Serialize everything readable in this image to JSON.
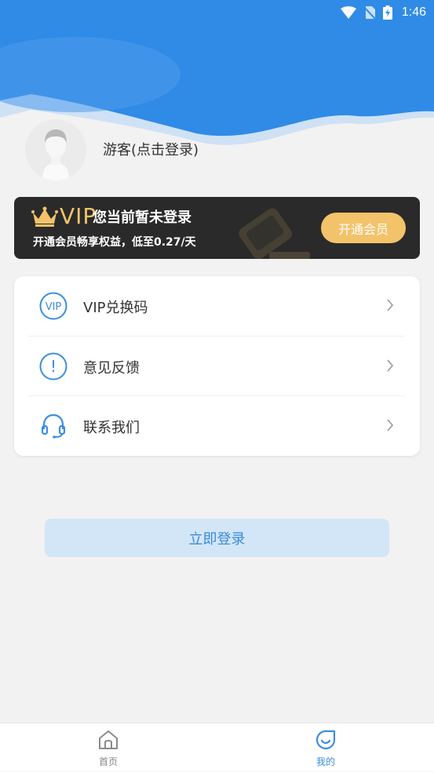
{
  "status_bar": {
    "time": "1:46"
  },
  "profile": {
    "username": "游客(点击登录)"
  },
  "vip_card": {
    "vip_word": "VIP",
    "title": "您当前暂未登录",
    "subtitle": "开通会员畅享权益，低至0.27/天",
    "button_label": "开通会员"
  },
  "menu": {
    "items": [
      {
        "label": "VIP兑换码",
        "icon_text": "VIP"
      },
      {
        "label": "意见反馈",
        "icon_text": "!"
      },
      {
        "label": "联系我们"
      }
    ]
  },
  "login_button": {
    "label": "立即登录"
  },
  "tabbar": {
    "tabs": [
      {
        "label": "首页"
      },
      {
        "label": "我的"
      }
    ]
  },
  "colors": {
    "header_blue": "#2f8be6",
    "accent": "#3a8ee0",
    "vip_gold": "#f3c36a",
    "vip_card_bg": "#2a2a2a",
    "login_button_bg": "#d3e6f8"
  }
}
